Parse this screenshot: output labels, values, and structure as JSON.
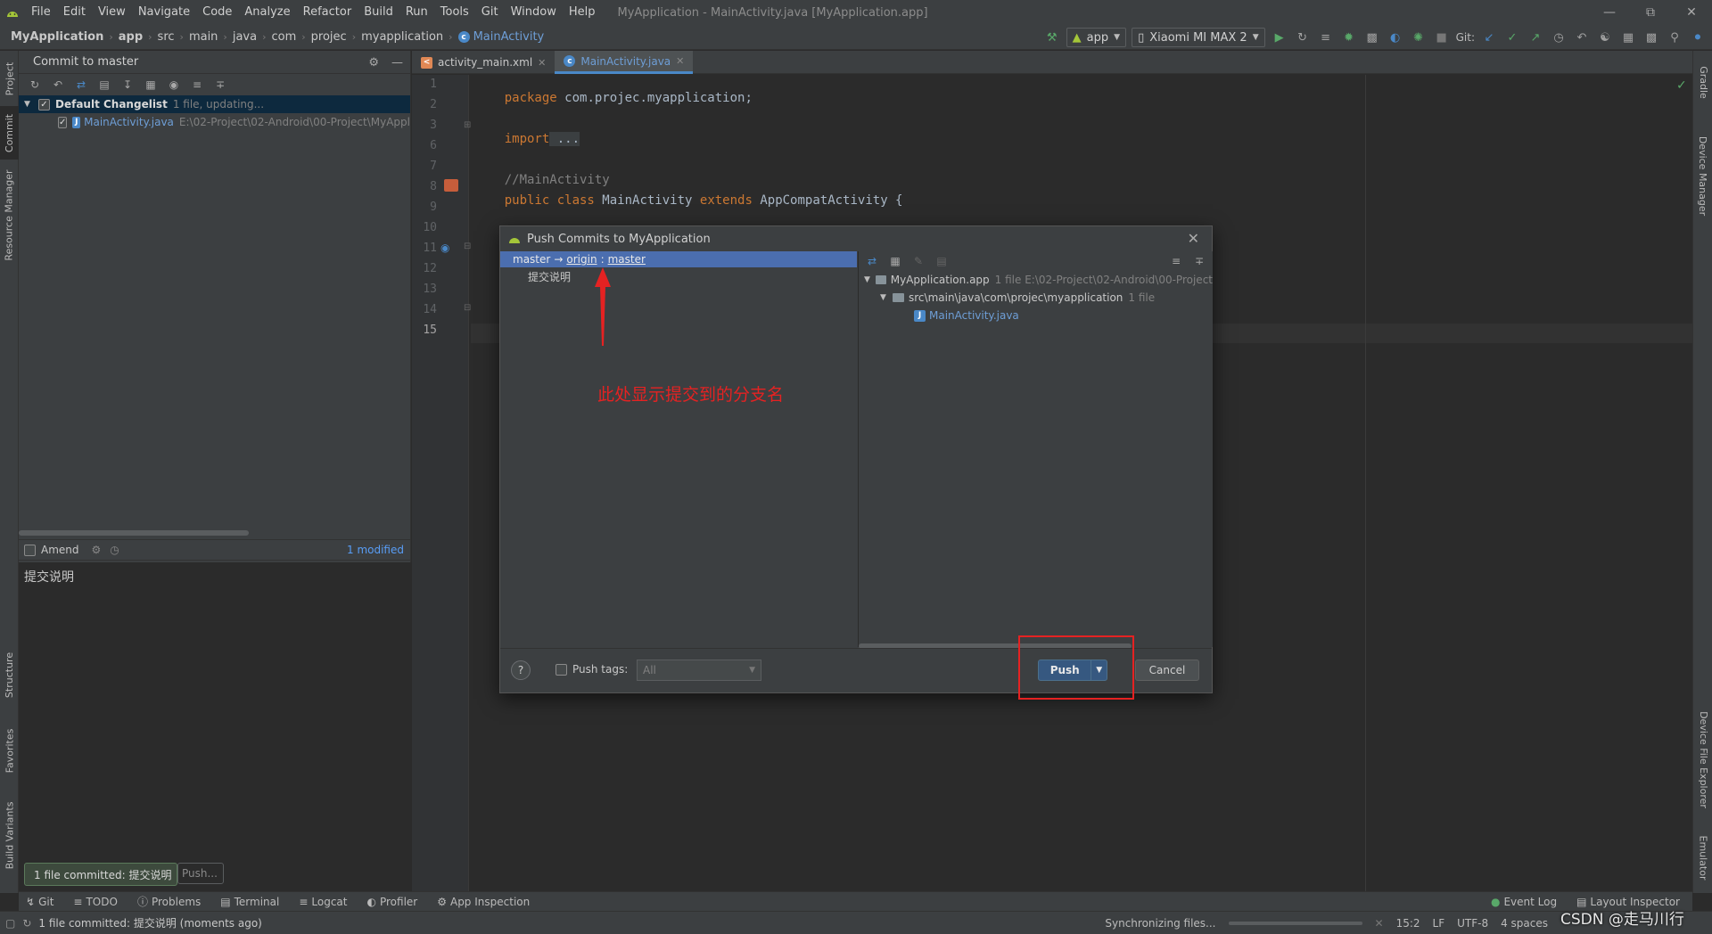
{
  "menubar": {
    "items": [
      "File",
      "Edit",
      "View",
      "Navigate",
      "Code",
      "Analyze",
      "Refactor",
      "Build",
      "Run",
      "Tools",
      "Git",
      "Window",
      "Help"
    ],
    "window_title": "MyApplication - MainActivity.java [MyApplication.app]"
  },
  "breadcrumbs": [
    "MyApplication",
    "app",
    "src",
    "main",
    "java",
    "com",
    "projec",
    "myapplication",
    "MainActivity"
  ],
  "toolbar": {
    "run_config": "app",
    "device": "Xiaomi MI MAX 2",
    "git_label": "Git:"
  },
  "left_tools": [
    "Project",
    "Commit",
    "Resource Manager",
    "Structure",
    "Favorites",
    "Build Variants"
  ],
  "right_tools": [
    "Gradle",
    "Device Manager",
    "Device File Explorer",
    "Emulator"
  ],
  "commit_panel": {
    "title": "Commit to master",
    "changelist_name": "Default Changelist",
    "changelist_info": "1 file, updating...",
    "file_name": "MainActivity.java",
    "file_path": "E:\\02-Project\\02-Android\\00-Project\\MyAppl",
    "amend_label": "Amend",
    "modified": "1 modified",
    "message": "提交说明"
  },
  "editor": {
    "tabs": [
      {
        "label": "activity_main.xml",
        "active": false
      },
      {
        "label": "MainActivity.java",
        "active": true
      }
    ],
    "line_numbers": [
      "1",
      "2",
      "3",
      "6",
      "7",
      "8",
      "9",
      "10",
      "11",
      "12",
      "13",
      "14",
      "15"
    ],
    "code": {
      "l1_kw": "package",
      "l1_rest": " com.projec.myapplication;",
      "l3_kw": "import",
      "l3_rest": " ...",
      "l7": "//MainActivity",
      "l8_kw1": "public class",
      "l8_name": " MainActivity ",
      "l8_kw2": "extends",
      "l8_rest": " AppCompatActivity {",
      "l15": "}"
    }
  },
  "dialog": {
    "title": "Push Commits to MyApplication",
    "branch_local": "master",
    "branch_arrow": "→",
    "branch_remote": "origin",
    "branch_sep": ":",
    "branch_target": "master",
    "commit_message": "提交说明",
    "tree": {
      "root": "MyApplication.app",
      "root_info": "1 file  E:\\02-Project\\02-Android\\00-Project",
      "folder": "src\\main\\java\\com\\projec\\myapplication",
      "folder_info": "1 file",
      "file": "MainActivity.java"
    },
    "push_tags_label": "Push tags:",
    "tags_value": "All",
    "push_label": "Push",
    "cancel_label": "Cancel",
    "help": "?"
  },
  "annotation": "此处显示提交到的分支名",
  "bottom_tabs": [
    "Git",
    "TODO",
    "Problems",
    "Terminal",
    "Logcat",
    "Profiler",
    "App Inspection"
  ],
  "bottom_right_tabs": [
    "Event Log",
    "Layout Inspector"
  ],
  "toast": "1 file committed: 提交说明",
  "push_ghost": "Push...",
  "status": {
    "message": "1 file committed: 提交说明 (moments ago)",
    "sync": "Synchronizing files...",
    "position": "15:2",
    "line_sep": "LF",
    "encoding": "UTF-8",
    "indent": "4 spaces"
  },
  "watermark": "CSDN @走马川行",
  "colors": {
    "accent": "#4b6eaf",
    "annotation": "#e52222",
    "primary_button": "#365880"
  }
}
